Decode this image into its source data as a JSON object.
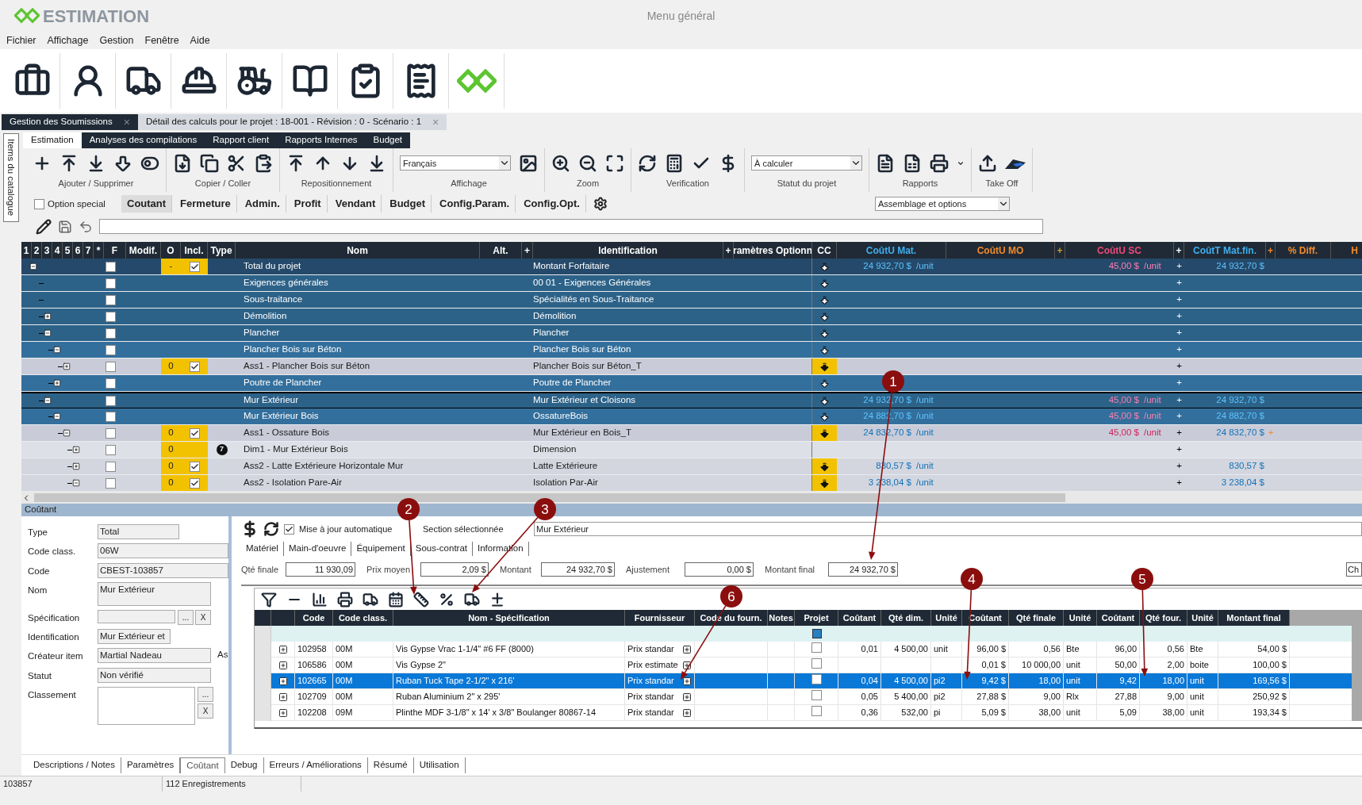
{
  "title_bar": {
    "logo": "ESTIMATION",
    "title": "Menu général"
  },
  "menu": [
    "Fichier",
    "Affichage",
    "Gestion",
    "Fenêtre",
    "Aide"
  ],
  "doc_tabs": [
    {
      "label": "Gestion des Soumissions",
      "close": "×",
      "selected": false
    },
    {
      "label": "Détail des calculs pour le projet : 18-001 - Révision : 0 - Scénario : 1",
      "close": "×",
      "selected": true
    }
  ],
  "side_tab": "Items du catalogue",
  "ribbon": {
    "tabs": [
      {
        "label": "Estimation",
        "selected": true
      },
      {
        "label": "Analyses des compilations",
        "selected": false
      },
      {
        "label": "Rapport client",
        "selected": false
      },
      {
        "label": "Rapports Internes",
        "selected": false
      },
      {
        "label": "Budget",
        "selected": false
      }
    ],
    "groups": [
      {
        "label": "Ajouter / Supprimer"
      },
      {
        "label": "Copier / Coller"
      },
      {
        "label": "Repositionnement"
      },
      {
        "label": "Affichage",
        "dropdown": "Français"
      },
      {
        "label": "Zoom"
      },
      {
        "label": "Verification"
      },
      {
        "label": "Statut du projet",
        "dropdown": "À calculer"
      },
      {
        "label": "Rapports"
      },
      {
        "label": "Take Off"
      }
    ]
  },
  "option_special": {
    "label": "Option special",
    "checked": false
  },
  "view_buttons": [
    {
      "label": "Coutant",
      "selected": true
    },
    {
      "label": "Fermeture",
      "selected": false
    },
    {
      "label": "Admin.",
      "selected": false
    },
    {
      "label": "Profit",
      "selected": false
    },
    {
      "label": "Vendant",
      "selected": false
    },
    {
      "label": "Budget",
      "selected": false
    },
    {
      "label": "Config.Param.",
      "selected": false
    },
    {
      "label": "Config.Opt.",
      "selected": false
    }
  ],
  "view_dropdown": "Assemblage et options",
  "tree": {
    "columns": [
      {
        "label": "1"
      },
      {
        "label": "2"
      },
      {
        "label": "3"
      },
      {
        "label": "4"
      },
      {
        "label": "5"
      },
      {
        "label": "6"
      },
      {
        "label": "7"
      },
      {
        "label": "*"
      },
      {
        "label": "F"
      },
      {
        "label": "Modif."
      },
      {
        "label": "O"
      },
      {
        "label": "Incl."
      },
      {
        "label": "Type"
      },
      {
        "label": "Nom"
      },
      {
        "label": "Alt."
      },
      {
        "label": "+"
      },
      {
        "label": "Identification"
      },
      {
        "label": "+"
      },
      {
        "label": "ramètres Optionn"
      },
      {
        "label": "CC"
      },
      {
        "label": "CoûtU Mat."
      },
      {
        "label": "CoûtU MO"
      },
      {
        "label": "+"
      },
      {
        "label": "CoûtU SC"
      },
      {
        "label": "+"
      },
      {
        "label": "CoûtT Mat.fin."
      },
      {
        "label": "+"
      },
      {
        "label": "% Diff."
      },
      {
        "label": "H"
      }
    ],
    "rows": [
      {
        "kind": "section",
        "name": "Total du projet",
        "identification": "Montant Forfaitaire",
        "expanded": true,
        "selected": false,
        "f_checked": false,
        "option": "-",
        "included": true,
        "cc_highlight": false,
        "mat": "24 932,70 $",
        "mat_unit": "/unit",
        "sc": "45,00 $",
        "sc_unit": "/unit",
        "sc_plus": "+",
        "total": "24 932,70 $",
        "children": [
          {
            "kind": "section",
            "name": "Exigences générales",
            "identification": "00 01 - Exigences Générales",
            "selected": false,
            "f_checked": false,
            "cc_highlight": false,
            "sc_plus": "+"
          },
          {
            "kind": "section",
            "name": "Sous-traitance",
            "identification": "Spécialités en Sous-Traitance",
            "selected": false,
            "f_checked": false,
            "cc_highlight": false,
            "sc_plus": "+"
          },
          {
            "kind": "section",
            "name": "Démolition",
            "identification": "Démolition",
            "expanded": false,
            "selected": false,
            "f_checked": false,
            "cc_highlight": false,
            "sc_plus": "+"
          },
          {
            "kind": "section",
            "name": "Plancher",
            "identification": "Plancher",
            "expanded": true,
            "selected": false,
            "f_checked": false,
            "cc_highlight": false,
            "sc_plus": "+",
            "children": [
              {
                "kind": "section",
                "name": "Plancher Bois sur Béton",
                "identification": "Plancher Bois sur Béton",
                "expanded": true,
                "selected": false,
                "f_checked": false,
                "cc_highlight": false,
                "sc_plus": "+",
                "children": [
                  {
                    "kind": "assembly",
                    "name": "Ass1 - Plancher Bois sur Béton",
                    "identification": "Plancher Bois sur Béton_T",
                    "expanded": false,
                    "selected": false,
                    "f_checked": false,
                    "option": "0",
                    "included": true,
                    "cc_highlight": true,
                    "sc_plus": "+"
                  }
                ]
              },
              {
                "kind": "section",
                "name": "Poutre de Plancher",
                "identification": "Poutre de Plancher",
                "expanded": false,
                "selected": false,
                "f_checked": false,
                "cc_highlight": false,
                "sc_plus": "+"
              }
            ]
          },
          {
            "kind": "section",
            "name": "Mur Extérieur",
            "identification": "Mur Extérieur et Cloisons",
            "expanded": true,
            "selected": true,
            "f_checked": false,
            "cc_highlight": false,
            "mat": "24 932,70 $",
            "mat_unit": "/unit",
            "sc": "45,00 $",
            "sc_unit": "/unit",
            "sc_plus": "+",
            "total": "24 932,70 $",
            "children": [
              {
                "kind": "section",
                "name": "Mur Extérieur Bois",
                "identification": "OssatureBois",
                "expanded": true,
                "selected": false,
                "f_checked": false,
                "cc_highlight": false,
                "mat": "24 882,70 $",
                "mat_unit": "/unit",
                "sc": "45,00 $",
                "sc_unit": "/unit",
                "sc_plus": "+",
                "total": "24 882,70 $",
                "children": [
                  {
                    "kind": "assembly",
                    "name": "Ass1 - Ossature Bois",
                    "identification": "Mur Extérieur en Bois_T",
                    "expanded": true,
                    "selected": false,
                    "f_checked": false,
                    "option": "0",
                    "included": true,
                    "cc_highlight": true,
                    "mat": "24 832,70 $",
                    "mat_unit": "/unit",
                    "sc": "45,00 $",
                    "sc_unit": "/unit",
                    "sc_plus": "+",
                    "total": "24 832,70 $",
                    "total_flag": "+",
                    "children": [
                      {
                        "kind": "dimension",
                        "name": "Dim1 - Mur Extérieur Bois",
                        "identification": "Dimension",
                        "expanded": false,
                        "selected": false,
                        "f_checked": false,
                        "option": "0",
                        "type": "7",
                        "sc_plus": "+"
                      },
                      {
                        "kind": "assembly",
                        "name": "Ass2 - Latte Extérieure Horizontale Mur",
                        "identification": "Latte Extérieure",
                        "expanded": false,
                        "selected": false,
                        "f_checked": false,
                        "option": "0",
                        "included": true,
                        "cc_highlight": true,
                        "mat": "830,57 $",
                        "mat_unit": "/unit",
                        "sc_plus": "+",
                        "total": "830,57 $"
                      },
                      {
                        "kind": "assembly",
                        "name": "Ass2 - Isolation Pare-Air",
                        "identification": "Isolation Par-Air",
                        "expanded": true,
                        "selected": false,
                        "f_checked": false,
                        "option": "0",
                        "included": true,
                        "cc_highlight": true,
                        "mat": "3 238,04 $",
                        "mat_unit": "/unit",
                        "sc_plus": "+",
                        "total": "3 238,04 $"
                      }
                    ]
                  }
                ]
              }
            ]
          }
        ]
      }
    ]
  },
  "detail": {
    "title": "Coûtant",
    "form": [
      {
        "kind": "field",
        "label": "Type",
        "value": "Total"
      },
      {
        "kind": "field",
        "label": "Code class.",
        "value": "06W"
      },
      {
        "kind": "field",
        "label": "Code",
        "value": "CBEST-103857"
      },
      {
        "kind": "area",
        "label": "Nom",
        "value": "Mur Extérieur"
      },
      {
        "kind": "pick",
        "label": "Spécification",
        "buttons": [
          "...",
          "X"
        ]
      },
      {
        "kind": "field",
        "label": "Identification",
        "value": "Mur Extérieur et"
      },
      {
        "kind": "field",
        "label": "Créateur item",
        "value": "Martial Nadeau",
        "suffix": "As"
      },
      {
        "kind": "field",
        "label": "Statut",
        "value": "Non vérifié"
      },
      {
        "kind": "pickarea",
        "label": "Classement",
        "buttons": [
          "...",
          "X"
        ]
      }
    ],
    "auto_update": {
      "label": "Mise à jour automatique",
      "checked": true
    },
    "section": {
      "label": "Section sélectionnée",
      "value": "Mur Extérieur"
    },
    "tabs": [
      "Matériel",
      "Main-d'oeuvre",
      "Équipement",
      "Sous-contrat",
      "Information"
    ],
    "totals": [
      {
        "label": "Qté finale",
        "value": "11 930,09"
      },
      {
        "label": "Prix moyen",
        "value": "2,09 $"
      },
      {
        "label": "Montant",
        "value": "24 932,70 $"
      },
      {
        "label": "Ajustement",
        "value": "0,00 $"
      },
      {
        "label": "Montant final",
        "value": "24 932,70 $"
      }
    ],
    "extra_field": "Ch",
    "grid": {
      "columns": [
        "",
        "",
        "Code",
        "Code class.",
        "Nom - Spécification",
        "Fournisseur",
        "Code du fourn.",
        "Notes",
        "Projet",
        "Coûtant",
        "Qté dim.",
        "Unité",
        "Coûtant",
        "Qté finale",
        "Unité",
        "Coûtant",
        "Qté four.",
        "Unité",
        "Montant final"
      ],
      "filter_project": true,
      "rows": [
        {
          "selected": false,
          "project": false,
          "code": "102958",
          "class": "00M",
          "name": "Vis Gypse Vrac 1-1/4\" #6 FF (8000)",
          "supplier": "Prix standar",
          "cost1": "0,01",
          "qty_dim": "4 500,00",
          "unit1": "unit",
          "cost2": "96,00 $",
          "qty_final": "0,56",
          "unit2": "Bte",
          "cost3": "96,00",
          "qty_supp": "0,56",
          "unit3": "Bte",
          "amount": "54,00 $"
        },
        {
          "selected": false,
          "project": false,
          "code": "106586",
          "class": "00M",
          "name": "Vis Gypse 2\"",
          "supplier": "Prix estimate",
          "cost2": "0,01 $",
          "qty_final": "10 000,00",
          "unit2": "unit",
          "cost3": "50,00",
          "qty_supp": "2,00",
          "unit3": "boite",
          "amount": "100,00 $"
        },
        {
          "selected": true,
          "project": false,
          "code": "102665",
          "class": "00M",
          "name": "Ruban Tuck Tape 2-1/2\" x 216'",
          "supplier": "Prix standar",
          "cost1": "0,04",
          "qty_dim": "4 500,00",
          "unit1": "pi2",
          "cost2": "9,42 $",
          "qty_final": "18,00",
          "unit2": "unit",
          "cost3": "9,42",
          "qty_supp": "18,00",
          "unit3": "unit",
          "amount": "169,56 $"
        },
        {
          "selected": false,
          "project": false,
          "code": "102709",
          "class": "00M",
          "name": "Ruban Aluminium 2\" x 295'",
          "supplier": "Prix standar",
          "cost1": "0,05",
          "qty_dim": "5 400,00",
          "unit1": "pi2",
          "cost2": "27,88 $",
          "qty_final": "9,00",
          "unit2": "Rlx",
          "cost3": "27,88",
          "qty_supp": "9,00",
          "unit3": "unit",
          "amount": "250,92 $"
        },
        {
          "selected": false,
          "project": false,
          "code": "102208",
          "class": "09M",
          "name": "Plinthe MDF  3-1/8\" x 14' x 3/8\" Boulanger 80867-14",
          "supplier": "Prix standar",
          "cost1": "0,36",
          "qty_dim": "532,00",
          "unit1": "pi",
          "cost2": "5,09 $",
          "qty_final": "38,00",
          "unit2": "unit",
          "cost3": "5,09",
          "qty_supp": "38,00",
          "unit3": "unit",
          "amount": "193,34 $"
        }
      ]
    }
  },
  "annotations": [
    "1",
    "2",
    "3",
    "4",
    "5",
    "6"
  ],
  "bottom_tabs": [
    {
      "label": "Descriptions / Notes",
      "selected": false
    },
    {
      "label": "Paramètres",
      "selected": false
    },
    {
      "label": "Coûtant",
      "selected": true
    },
    {
      "label": "Debug",
      "selected": false
    },
    {
      "label": "Erreurs / Améliorations",
      "selected": false
    },
    {
      "label": "Résumé",
      "selected": false
    },
    {
      "label": "Utilisation",
      "selected": false
    }
  ],
  "status_bar": [
    "103857",
    "112 Enregistrements"
  ]
}
